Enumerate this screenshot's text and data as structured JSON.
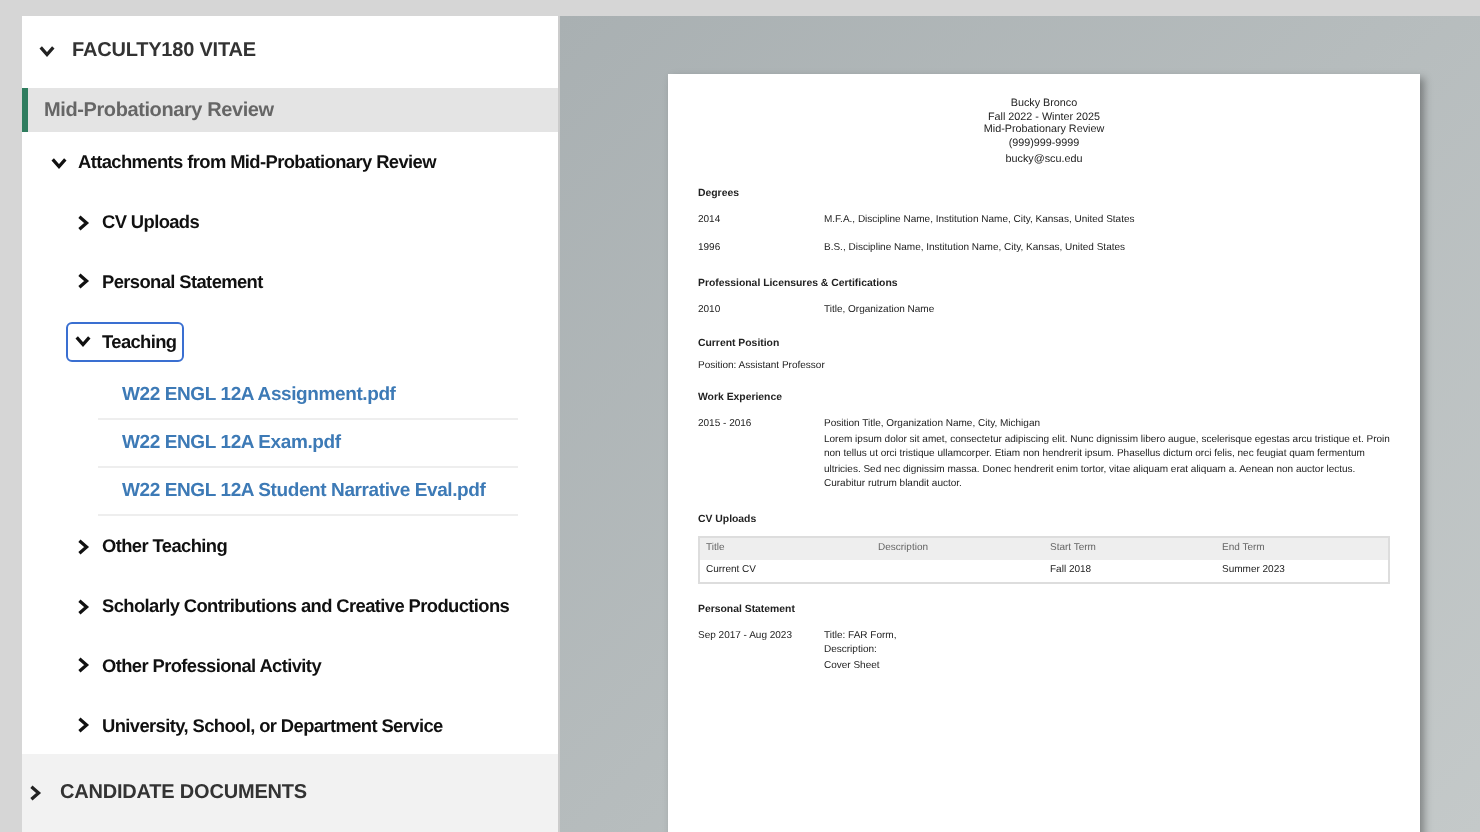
{
  "sidebar": {
    "sections": [
      {
        "label": "FACULTY180 VITAE",
        "expanded": true,
        "items": [
          {
            "kind": "page",
            "label": "Mid-Probationary Review",
            "selected": true
          },
          {
            "kind": "folder",
            "label": "Attachments from Mid-Probationary Review",
            "expanded": true,
            "focused": false,
            "children": [
              {
                "kind": "folder",
                "label": "CV Uploads",
                "expanded": false,
                "focused": false
              },
              {
                "kind": "folder",
                "label": "Personal Statement",
                "expanded": false,
                "focused": false
              },
              {
                "kind": "folder",
                "label": "Teaching",
                "expanded": true,
                "focused": true,
                "children": [
                  {
                    "kind": "file",
                    "label": "W22 ENGL 12A Assignment.pdf"
                  },
                  {
                    "kind": "file",
                    "label": "W22 ENGL 12A Exam.pdf"
                  },
                  {
                    "kind": "file",
                    "label": "W22 ENGL 12A Student Narrative Eval.pdf"
                  }
                ]
              },
              {
                "kind": "folder",
                "label": "Other Teaching",
                "expanded": false,
                "focused": false
              },
              {
                "kind": "folder",
                "label": "Scholarly Contributions and Creative Productions",
                "expanded": false,
                "focused": false
              },
              {
                "kind": "folder",
                "label": "Other Professional Activity",
                "expanded": false,
                "focused": false
              },
              {
                "kind": "folder",
                "label": "University, School, or Department Service",
                "expanded": false,
                "focused": false
              }
            ]
          }
        ]
      },
      {
        "label": "CANDIDATE DOCUMENTS",
        "expanded": false
      }
    ]
  },
  "document": {
    "header": [
      "Bucky Bronco",
      "Fall 2022 - Winter 2025",
      "Mid-Probationary Review",
      "(999)999-9999",
      "bucky@scu.edu"
    ],
    "sections": [
      {
        "kind": "dated",
        "title": "Degrees",
        "rows": [
          {
            "date": "2014",
            "lines": [
              "M.F.A., Discipline Name, Institution Name, City, Kansas, United States"
            ]
          },
          {
            "date": "1996",
            "lines": [
              "B.S., Discipline Name, Institution Name, City, Kansas, United States"
            ]
          }
        ]
      },
      {
        "kind": "dated",
        "title": "Professional Licensures & Certifications",
        "rows": [
          {
            "date": "2010",
            "lines": [
              "Title, Organization Name"
            ]
          }
        ]
      },
      {
        "kind": "text",
        "title": "Current Position",
        "text": "Position:  Assistant Professor"
      },
      {
        "kind": "dated",
        "title": "Work Experience",
        "rows": [
          {
            "date": "2015 - 2016",
            "lines": [
              "Position Title, Organization Name, City, Michigan",
              "Lorem ipsum dolor sit amet, consectetur adipiscing elit. Nunc dignissim libero augue, scelerisque egestas arcu tristique et. Proin non tellus ut orci tristique ullamcorper. Etiam non hendrerit ipsum. Phasellus dictum orci felis, nec feugiat quam fermentum ultricies. Sed nec dignissim massa. Donec hendrerit enim tortor, vitae aliquam erat aliquam a. Aenean non auctor lectus. Curabitur rutrum blandit auctor."
            ]
          }
        ]
      },
      {
        "kind": "table",
        "title": "CV Uploads",
        "columns": [
          "Title",
          "Description",
          "Start Term",
          "End Term"
        ],
        "rows": [
          {
            "title": "Current CV",
            "start_term": "Fall 2018",
            "end_term": "Summer 2023"
          }
        ]
      },
      {
        "kind": "dated",
        "title": "Personal Statement",
        "rows": [
          {
            "date": "Sep 2017 - Aug 2023",
            "lines": [
              "Title: FAR Form,",
              "Description:",
              "Cover Sheet"
            ]
          }
        ]
      }
    ]
  }
}
